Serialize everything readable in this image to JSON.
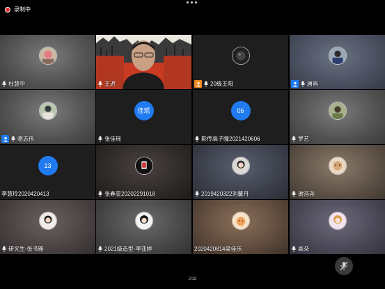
{
  "topbar": {
    "recording_label": "录制中",
    "more_icon": "ellipsis-icon"
  },
  "colors": {
    "accent_blue": "#1f7bef",
    "host_orange": "#f0891f",
    "record_red": "#e52d2d"
  },
  "participants": [
    {
      "name": "杜慧中",
      "kind": "avatar",
      "host_badge": "none"
    },
    {
      "name": "王迟",
      "kind": "video",
      "host_badge": "none"
    },
    {
      "name": "20级王阳",
      "kind": "avatar",
      "host_badge": "orange"
    },
    {
      "name": "唐晋",
      "kind": "avatar",
      "host_badge": "blue"
    },
    {
      "name": "骆志伟",
      "kind": "avatar",
      "host_badge": "blue"
    },
    {
      "name": "张佳瑶",
      "kind": "initials",
      "initials": "佳瑶",
      "host_badge": "none"
    },
    {
      "name": "影传高子瞳2021420606",
      "kind": "initials",
      "initials": "06",
      "host_badge": "none"
    },
    {
      "name": "罗艺",
      "kind": "avatar",
      "host_badge": "none"
    },
    {
      "name": "李慧玲2020420413",
      "kind": "initials",
      "initials": "13",
      "host_badge": "none",
      "no_mic": true
    },
    {
      "name": "张春亚20202291018",
      "kind": "avatar",
      "host_badge": "none"
    },
    {
      "name": "2019420322刘馨丹",
      "kind": "avatar",
      "host_badge": "none"
    },
    {
      "name": "谢浩尧",
      "kind": "avatar",
      "host_badge": "none"
    },
    {
      "name": "研究生-张书雅",
      "kind": "avatar",
      "host_badge": "none"
    },
    {
      "name": "2021级造型-李亚婷",
      "kind": "avatar",
      "host_badge": "none"
    },
    {
      "name": "2020420814梁佳乐",
      "kind": "avatar",
      "host_badge": "none",
      "no_mic": true
    },
    {
      "name": "高朵",
      "kind": "avatar",
      "host_badge": "none"
    }
  ],
  "footer": {
    "page_indicator": "2/18",
    "mic_icon": "mic-muted-icon"
  }
}
